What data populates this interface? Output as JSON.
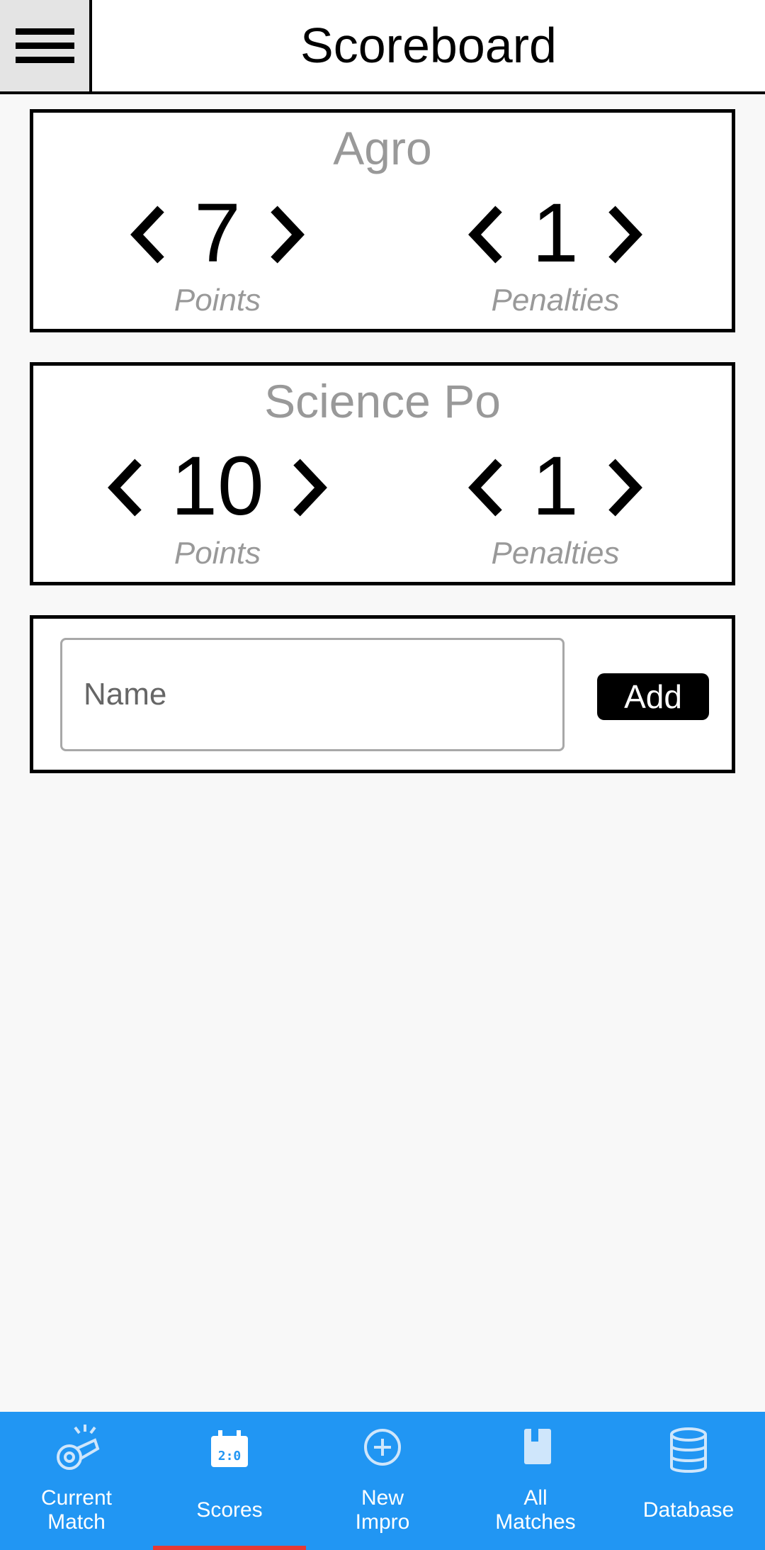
{
  "header": {
    "title": "Scoreboard",
    "menu_icon": "hamburger-menu-icon"
  },
  "teams": [
    {
      "name": "Agro",
      "points": 7,
      "penalties": 1,
      "points_label": "Points",
      "penalties_label": "Penalties"
    },
    {
      "name": "Science Po",
      "points": 10,
      "penalties": 1,
      "points_label": "Points",
      "penalties_label": "Penalties"
    }
  ],
  "add_team": {
    "placeholder": "Name",
    "value": "",
    "button_label": "Add"
  },
  "bottom_nav": {
    "items": [
      {
        "label": "Current\nMatch",
        "icon": "whistle-icon"
      },
      {
        "label": "Scores",
        "icon": "scoreboard-calendar-icon",
        "active": true
      },
      {
        "label": "New\nImpro",
        "icon": "plus-circle-icon"
      },
      {
        "label": "All\nMatches",
        "icon": "book-icon"
      },
      {
        "label": "Database",
        "icon": "database-icon"
      }
    ],
    "background_color": "#2196f3",
    "active_indicator_color": "#e53935"
  }
}
